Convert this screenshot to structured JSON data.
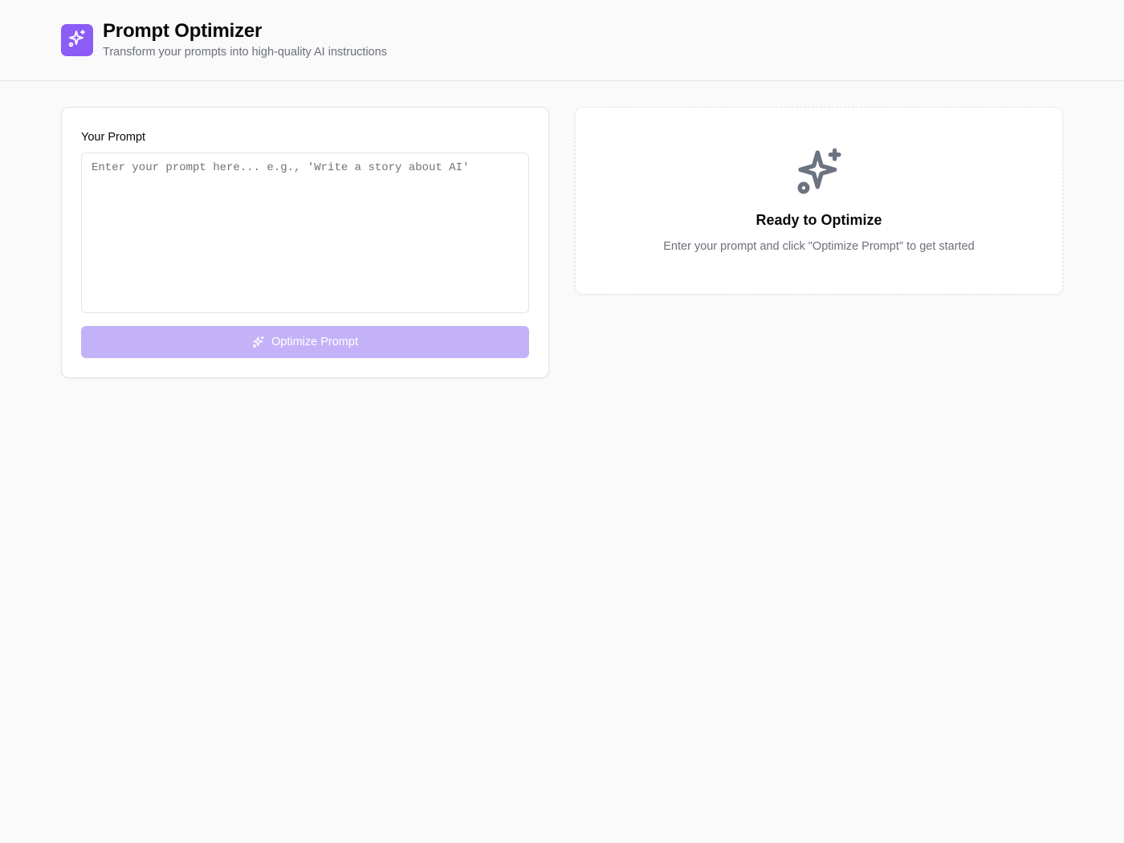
{
  "header": {
    "title": "Prompt Optimizer",
    "subtitle": "Transform your prompts into high-quality AI instructions",
    "logo_icon": "sparkles-icon",
    "logo_color": "#8b5cf6"
  },
  "input_panel": {
    "label": "Your Prompt",
    "textarea": {
      "value": "",
      "placeholder": "Enter your prompt here... e.g., 'Write a story about AI'"
    },
    "button": {
      "label": "Optimize Prompt",
      "icon": "sparkles-icon",
      "state": "disabled",
      "color": "#c4b2f8"
    }
  },
  "output_panel": {
    "icon": "sparkles-icon",
    "title": "Ready to Optimize",
    "description": "Enter your prompt and click \"Optimize Prompt\" to get started"
  }
}
